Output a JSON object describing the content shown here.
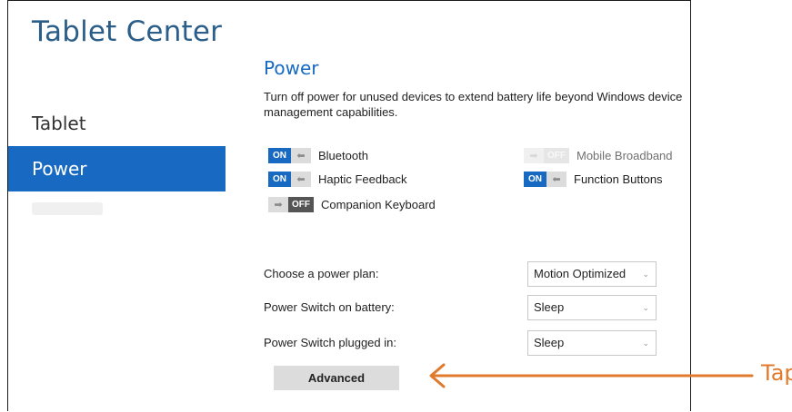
{
  "app": {
    "title": "Tablet Center"
  },
  "sidebar": {
    "items": [
      {
        "label": "Tablet",
        "selected": false
      },
      {
        "label": "Power",
        "selected": true
      }
    ]
  },
  "section": {
    "title": "Power",
    "description": "Turn off power for unused devices to extend battery life beyond Windows device management capabilities."
  },
  "toggles": {
    "bluetooth": {
      "label": "Bluetooth",
      "state": "ON",
      "enabled": true
    },
    "haptic_feedback": {
      "label": "Haptic Feedback",
      "state": "ON",
      "enabled": true
    },
    "companion_keyboard": {
      "label": "Companion Keyboard",
      "state": "OFF",
      "enabled": true
    },
    "mobile_broadband": {
      "label": "Mobile Broadband",
      "state": "OFF",
      "enabled": false
    },
    "function_buttons": {
      "label": "Function Buttons",
      "state": "ON",
      "enabled": true
    }
  },
  "settings": {
    "power_plan": {
      "label": "Choose a power plan:",
      "value": "Motion Optimized"
    },
    "switch_battery": {
      "label": "Power Switch on battery:",
      "value": "Sleep"
    },
    "switch_plugged": {
      "label": "Power Switch plugged in:",
      "value": "Sleep"
    }
  },
  "buttons": {
    "advanced": "Advanced"
  },
  "annotation": {
    "label": "Tap",
    "color": "#e07b2e"
  },
  "colors": {
    "accent": "#1769c2",
    "title": "#2b5f8a"
  }
}
